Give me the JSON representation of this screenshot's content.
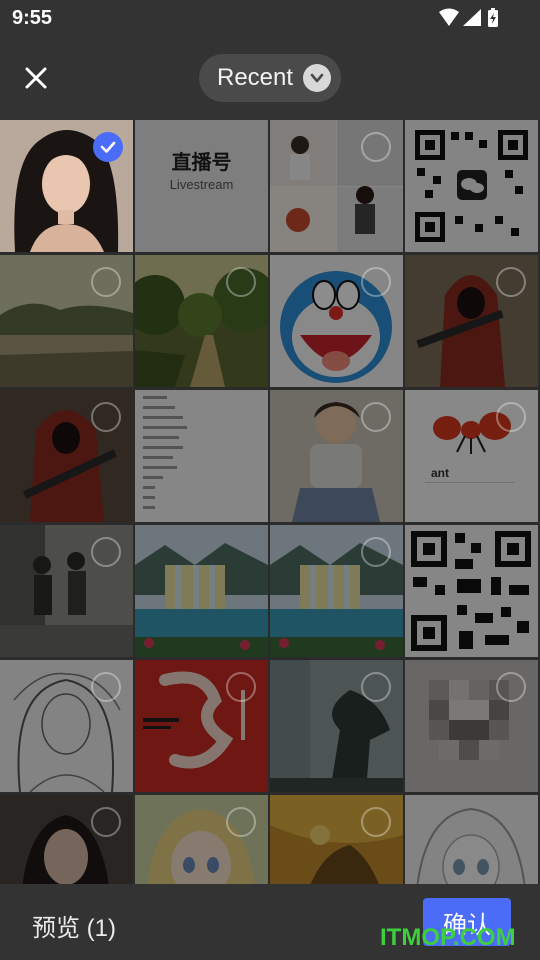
{
  "status_bar": {
    "time": "9:55"
  },
  "header": {
    "album": "Recent"
  },
  "footer": {
    "preview": "预览 (1)",
    "confirm": "确认"
  },
  "colors": {
    "accent": "#4a6cf7",
    "background": "#2b2b2b",
    "bar": "#333333"
  },
  "grid": {
    "items": [
      {
        "id": "portrait-woman",
        "selected": true
      },
      {
        "id": "livestream-logo",
        "text": [
          "直播号",
          "Livestream"
        ],
        "selected": false
      },
      {
        "id": "photo-collage",
        "selected": false
      },
      {
        "id": "qr-code-wechat",
        "selected": false
      },
      {
        "id": "landscape-lake",
        "selected": false
      },
      {
        "id": "forest-path",
        "selected": false
      },
      {
        "id": "doraemon",
        "selected": false
      },
      {
        "id": "hooded-soldier",
        "selected": false
      },
      {
        "id": "hooded-soldier-2",
        "selected": false
      },
      {
        "id": "text-list",
        "selected": false
      },
      {
        "id": "sitting-boy",
        "selected": false
      },
      {
        "id": "cartoon-ant",
        "text": [
          "ant"
        ],
        "selected": false
      },
      {
        "id": "couple-walking",
        "selected": false
      },
      {
        "id": "waterfall",
        "selected": false
      },
      {
        "id": "waterfall-2",
        "selected": false
      },
      {
        "id": "qr-code",
        "selected": false
      },
      {
        "id": "sketch-girl",
        "selected": false
      },
      {
        "id": "red-poster",
        "selected": false
      },
      {
        "id": "foggy-tree",
        "selected": false
      },
      {
        "id": "pixelated-image",
        "selected": false
      },
      {
        "id": "portrait-woman-2",
        "selected": false
      },
      {
        "id": "anime-girl",
        "selected": false
      },
      {
        "id": "yellow-illustration",
        "selected": false
      },
      {
        "id": "anime-sketch",
        "selected": false
      }
    ]
  },
  "watermark": "ITMOP.COM"
}
